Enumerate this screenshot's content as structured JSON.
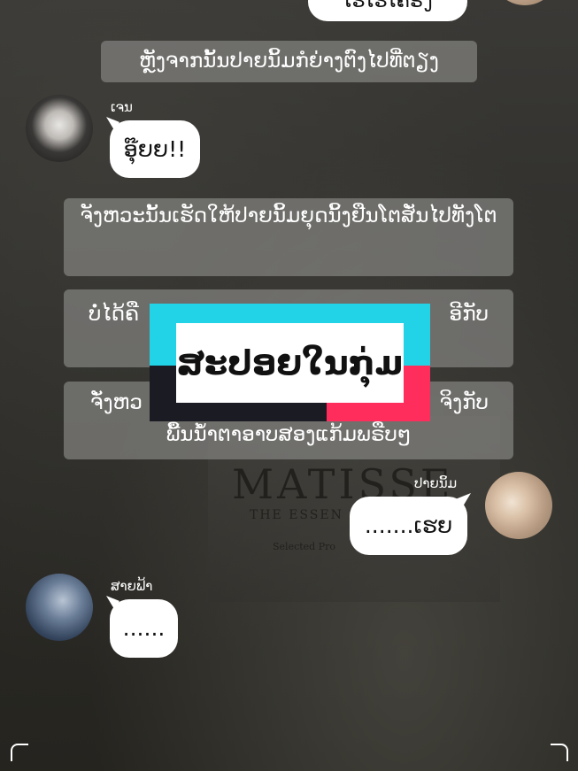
{
  "top_bubble": "ໂຮໂຮໂຄຣງ",
  "narration_1": "ຫຼັງຈາກນັ້ນປາຍນິ້ມກໍຍ່າງຕົງໄປທີ່ຕຽງ",
  "msg_jen": {
    "name": "ເຈນ",
    "text": "ອຸ໊ຍຍ!!"
  },
  "narration_2": "ຈັງຫວະນັ້ນເຮັດໃຫ້ປາຍນິ້ມຍຸດນິ້ງຢືນໂຕສັ່ນໄປທັງໂຕ",
  "narration_3a": "ບໍ່ໄດ້ຄື",
  "narration_3b": "ອີກັບ",
  "narration_4a": "ຈັ່ງຫວ",
  "narration_4b": "ຈິງກັບ",
  "narration_4c": "ພື້ນນ້ຳຕາອາບສອງແກ້ມພຣືບໆ",
  "logo_text": "ສະປອຍໃນກຸ່ມ",
  "msg_paynim": {
    "name": "ປາຍນິ້ມ",
    "text": ".......ເຮຍ"
  },
  "msg_saifa": {
    "name": "ສາຍຟ້າ",
    "text": "......"
  },
  "background": {
    "title": "MATISSE",
    "subtitle": "THE ESSEN",
    "small": "Selected Pro"
  },
  "colors": {
    "cyan": "#22d3e8",
    "pink": "#ff2d5c",
    "dark": "#1b1b24"
  }
}
